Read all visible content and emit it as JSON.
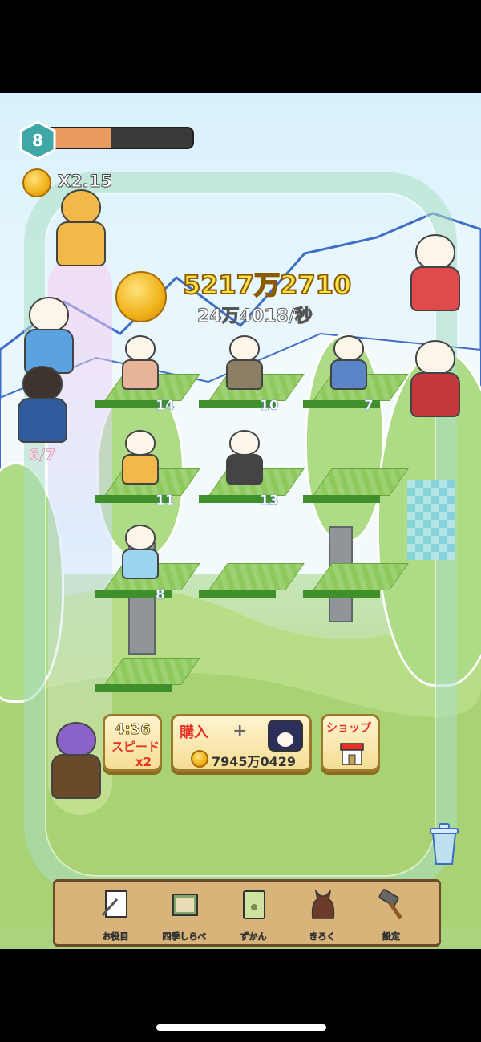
{
  "player": {
    "level": "8",
    "xp_fraction": 0.42
  },
  "multiplier": {
    "label": "X2.15"
  },
  "currency": {
    "total": "5217万2710",
    "rate": "24万4018/秒"
  },
  "tiles": [
    {
      "level": "14",
      "char_color": "#e7b49a"
    },
    {
      "level": "10",
      "char_color": "#8c7f66"
    },
    {
      "level": "7",
      "char_color": "#5a86c8"
    },
    {
      "level": "11",
      "char_color": "#f2b94a"
    },
    {
      "level": "13",
      "char_color": "#444444"
    },
    {
      "level": "",
      "char_color": ""
    },
    {
      "level": "8",
      "char_color": "#9bd5f0"
    },
    {
      "level": "",
      "char_color": ""
    },
    {
      "level": "",
      "char_color": ""
    },
    {
      "level": "",
      "char_color": ""
    }
  ],
  "party": {
    "count": "6/7"
  },
  "timer": {
    "time": "4:36",
    "speed_label": "スピード",
    "speed_mult": "x2"
  },
  "buy": {
    "label": "購入",
    "plus": "+",
    "cost": "7945万0429"
  },
  "shop": {
    "label": "ショップ"
  },
  "menu": [
    {
      "label": "お役目",
      "icon": "quest-paper-icon"
    },
    {
      "label": "四季しらべ",
      "icon": "scroll-icon"
    },
    {
      "label": "ずかん",
      "icon": "book-icon"
    },
    {
      "label": "きろく",
      "icon": "cat-silhouette-icon"
    },
    {
      "label": "設定",
      "icon": "hammer-icon"
    }
  ],
  "colors": {
    "accent": "#ffe14a",
    "button_text": "#e5332a",
    "xp_fill": "#e99a5e"
  }
}
